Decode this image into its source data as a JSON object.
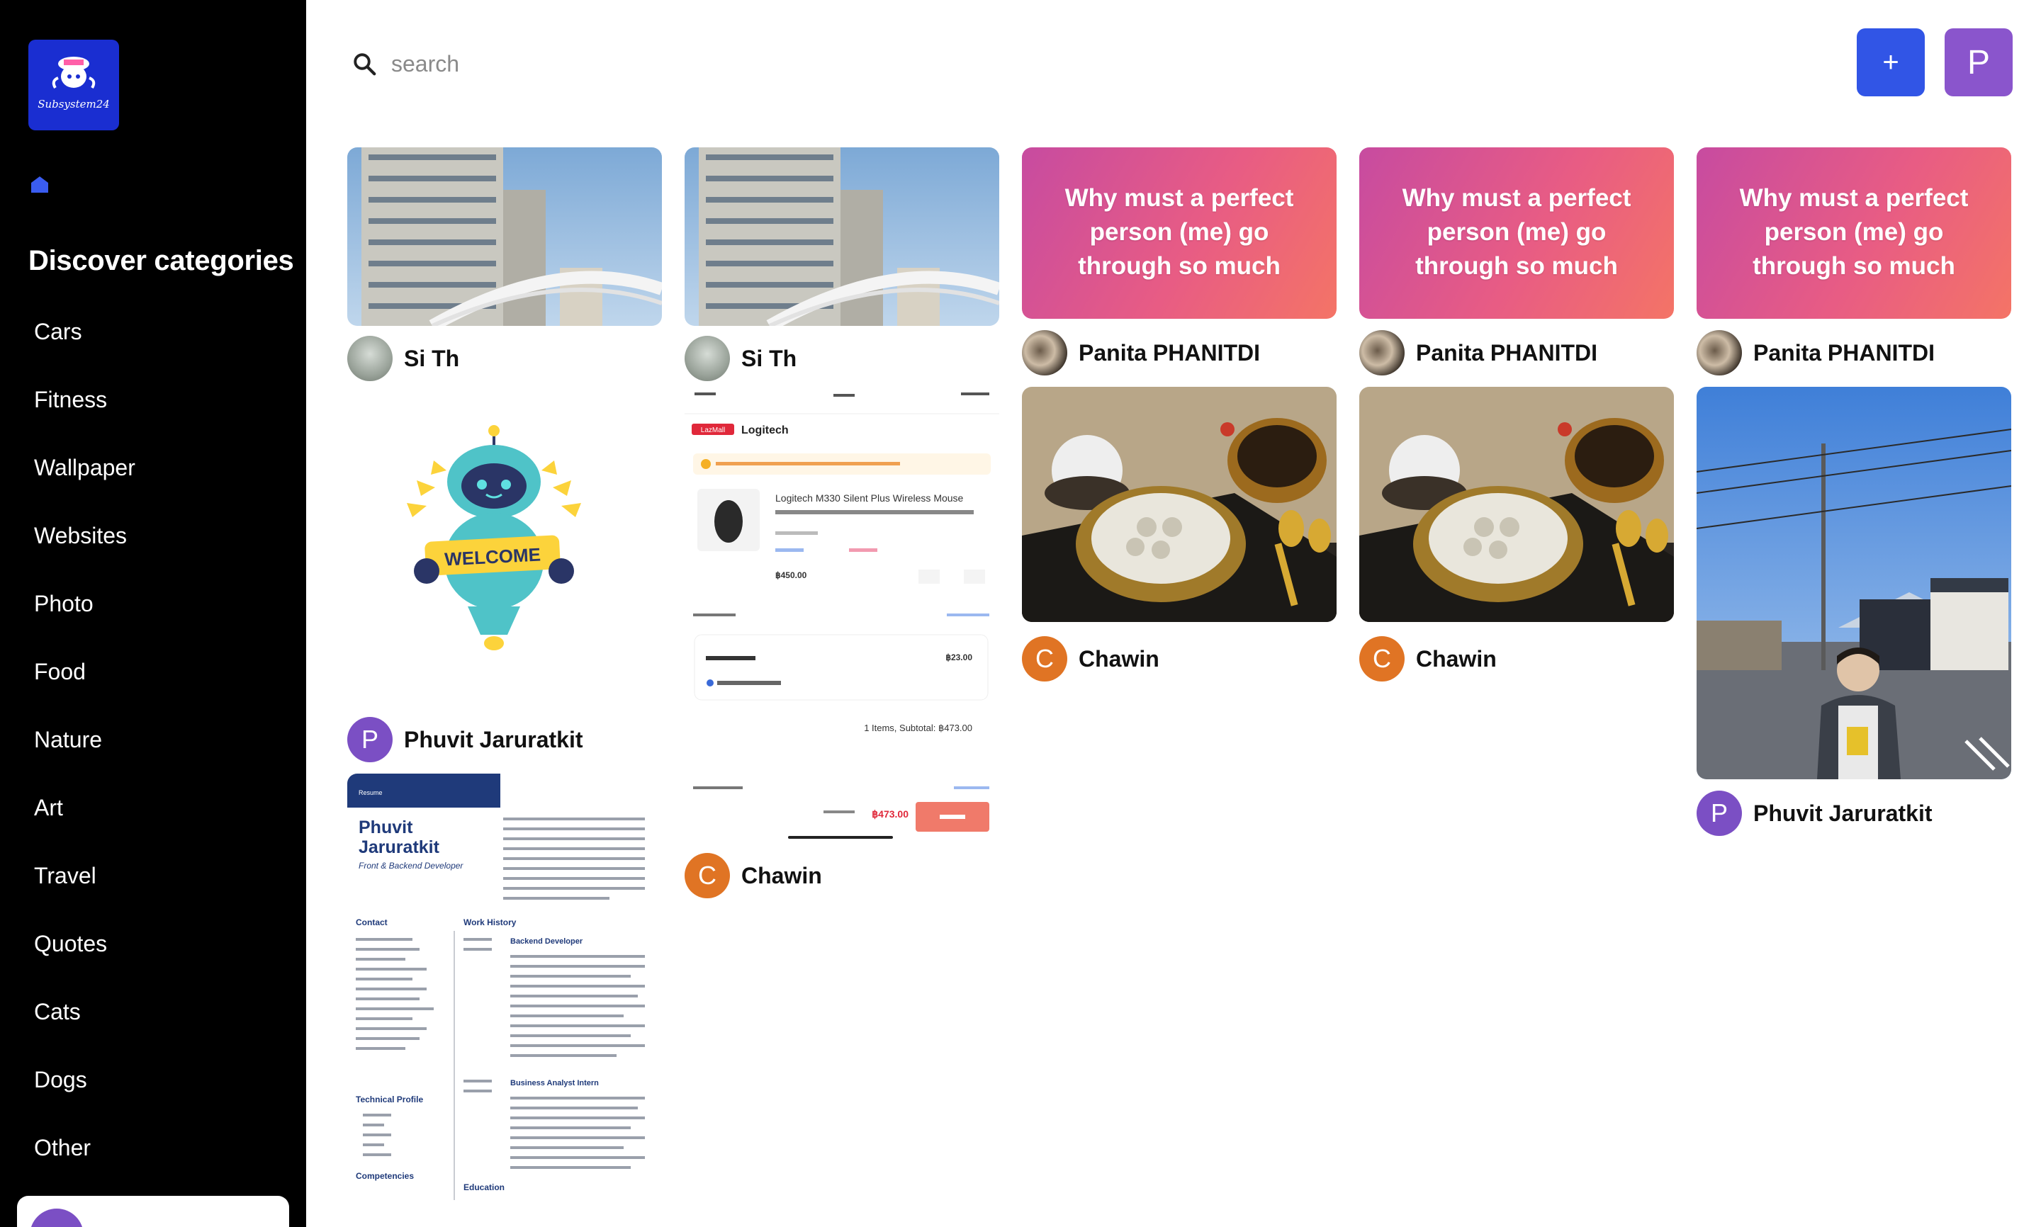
{
  "sidebar": {
    "logo_text": "Subsystem24",
    "title": "Discover categories",
    "categories": [
      "Cars",
      "Fitness",
      "Wallpaper",
      "Websites",
      "Photo",
      "Food",
      "Nature",
      "Art",
      "Travel",
      "Quotes",
      "Cats",
      "Dogs",
      "Other"
    ]
  },
  "header": {
    "search_placeholder": "search",
    "add_label": "+",
    "user_initial": "P"
  },
  "pins": {
    "p1": {
      "author": "Si Th"
    },
    "p2": {
      "author": "Phuvit Jaruratkit",
      "initial": "P",
      "image_text": "WELCOME"
    },
    "p3": {
      "resume_tag": "Resume",
      "name_line1": "Phuvit",
      "name_line2": "Jaruratkit",
      "role": "Front & Backend Developer",
      "contact": "Contact",
      "work_history": "Work History",
      "job1": "Backend Developer",
      "job2": "Business Analyst Intern",
      "technical_profile": "Technical Profile",
      "competencies": "Competencies",
      "education": "Education"
    },
    "p4": {
      "author": "Si Th"
    },
    "p5": {
      "shop": "Logitech",
      "mall_tag": "LazMall",
      "product": "Logitech M330 Silent Plus Wireless Mouse",
      "price": "฿450.00",
      "shipping_fee": "฿23.00",
      "subtotal": "1 Items, Subtotal: ฿473.00",
      "total": "฿473.00",
      "author": "Chawin",
      "initial": "C"
    },
    "p6": {
      "quote": "Why must a perfect person (me) go through so much",
      "author": "Panita PHANITDI"
    },
    "p7": {
      "author": "Chawin",
      "initial": "C"
    },
    "p8": {
      "quote": "Why must a perfect person (me) go through so much",
      "author": "Panita PHANITDI"
    },
    "p9": {
      "author": "Chawin",
      "initial": "C"
    },
    "p10": {
      "quote": "Why must a perfect person (me) go through so much",
      "author": "Panita PHANITDI"
    },
    "p11": {
      "author": "Phuvit Jaruratkit",
      "initial": "P"
    }
  },
  "colors": {
    "sidebar_bg": "#000000",
    "logo_bg": "#1a2ed1",
    "add_button": "#3155e6",
    "user_button": "#8a55cc",
    "avatar_orange": "#e07424",
    "avatar_purple": "#7b4fc4"
  }
}
